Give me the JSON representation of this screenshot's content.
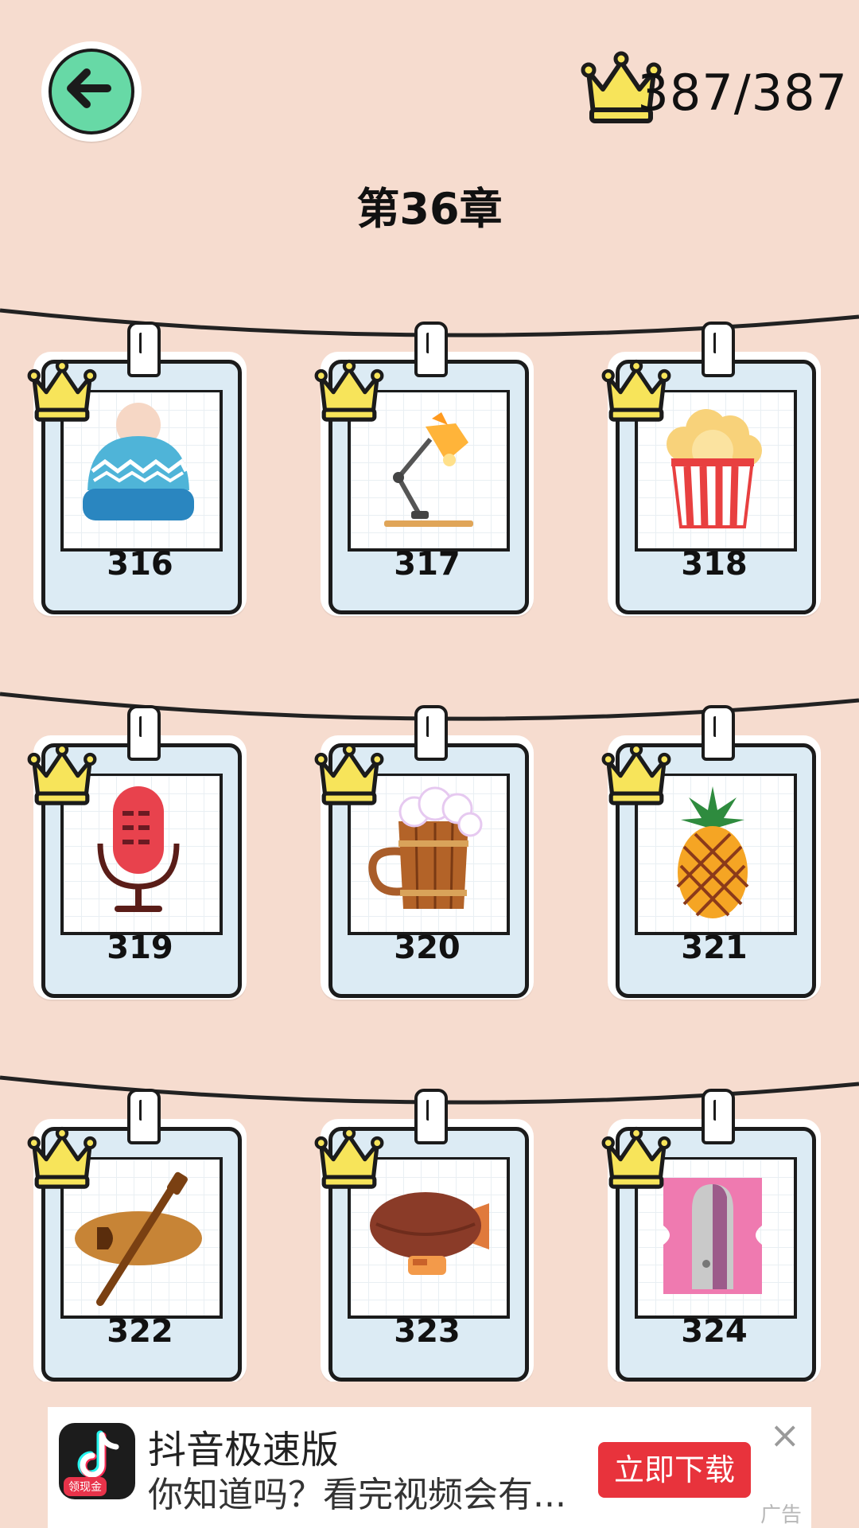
{
  "header": {
    "counter": "387/387",
    "chapter_title": "第36章"
  },
  "levels": [
    {
      "number": "316",
      "item": "knit-hat"
    },
    {
      "number": "317",
      "item": "desk-lamp"
    },
    {
      "number": "318",
      "item": "popcorn"
    },
    {
      "number": "319",
      "item": "microphone"
    },
    {
      "number": "320",
      "item": "beer-mug"
    },
    {
      "number": "321",
      "item": "pineapple"
    },
    {
      "number": "322",
      "item": "canoe"
    },
    {
      "number": "323",
      "item": "airship"
    },
    {
      "number": "324",
      "item": "pencil-sharpener"
    }
  ],
  "ad": {
    "logo_tag": "领现金",
    "title": "抖音极速版",
    "description": "你知道吗？看完视频会有...",
    "button": "立即下载",
    "close": "×",
    "label": "广告"
  },
  "colors": {
    "background": "#f6dccf",
    "back_button": "#67d9a6",
    "crown": "#f7e45a",
    "card_frame": "#dcebf4",
    "ad_button": "#e8333c"
  }
}
